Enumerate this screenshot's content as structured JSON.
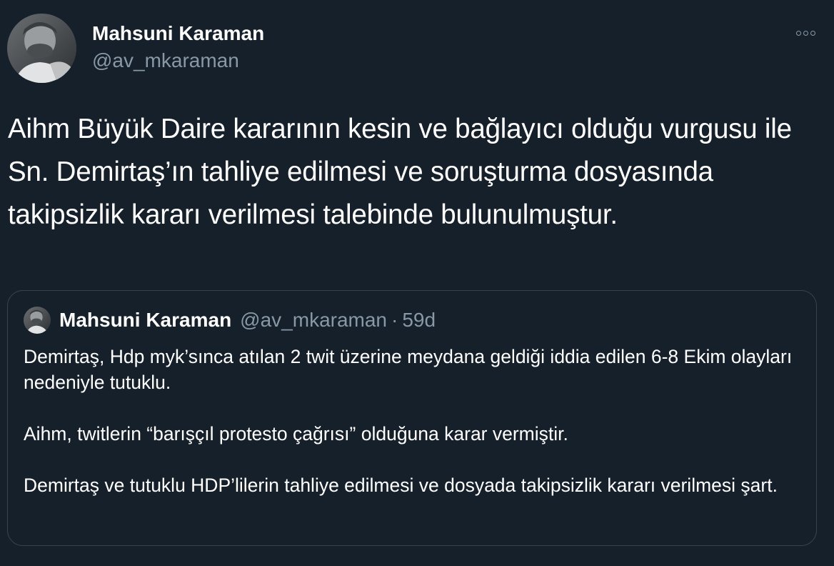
{
  "tweet": {
    "author_name": "Mahsuni Karaman",
    "author_handle": "@av_mkaraman",
    "text": "Aihm Büyük Daire kararının kesin ve bağlayıcı olduğu vurgusu ile Sn. Demirtaş’ın tahliye edilmesi ve soruşturma dosyasında takipsizlik kararı verilmesi talebinde bulunulmuştur.",
    "more_icon": "more-dots-icon"
  },
  "quoted": {
    "author_name": "Mahsuni Karaman",
    "author_handle": "@av_mkaraman",
    "separator": "·",
    "time": "59d",
    "paragraphs": [
      "Demirtaş, Hdp myk’sınca atılan 2 twit üzerine meydana geldiği iddia edilen 6-8 Ekim olayları nedeniyle tutuklu.",
      "Aihm, twitlerin “barışçıl protesto çağrısı” olduğuna karar vermiştir.",
      "Demirtaş ve tutuklu HDP’lilerin tahliye edilmesi ve dosyada takipsizlik kararı verilmesi şart."
    ]
  },
  "colors": {
    "background": "#15202b",
    "text": "#ffffff",
    "secondary": "#8899a6",
    "border": "#38444d"
  }
}
